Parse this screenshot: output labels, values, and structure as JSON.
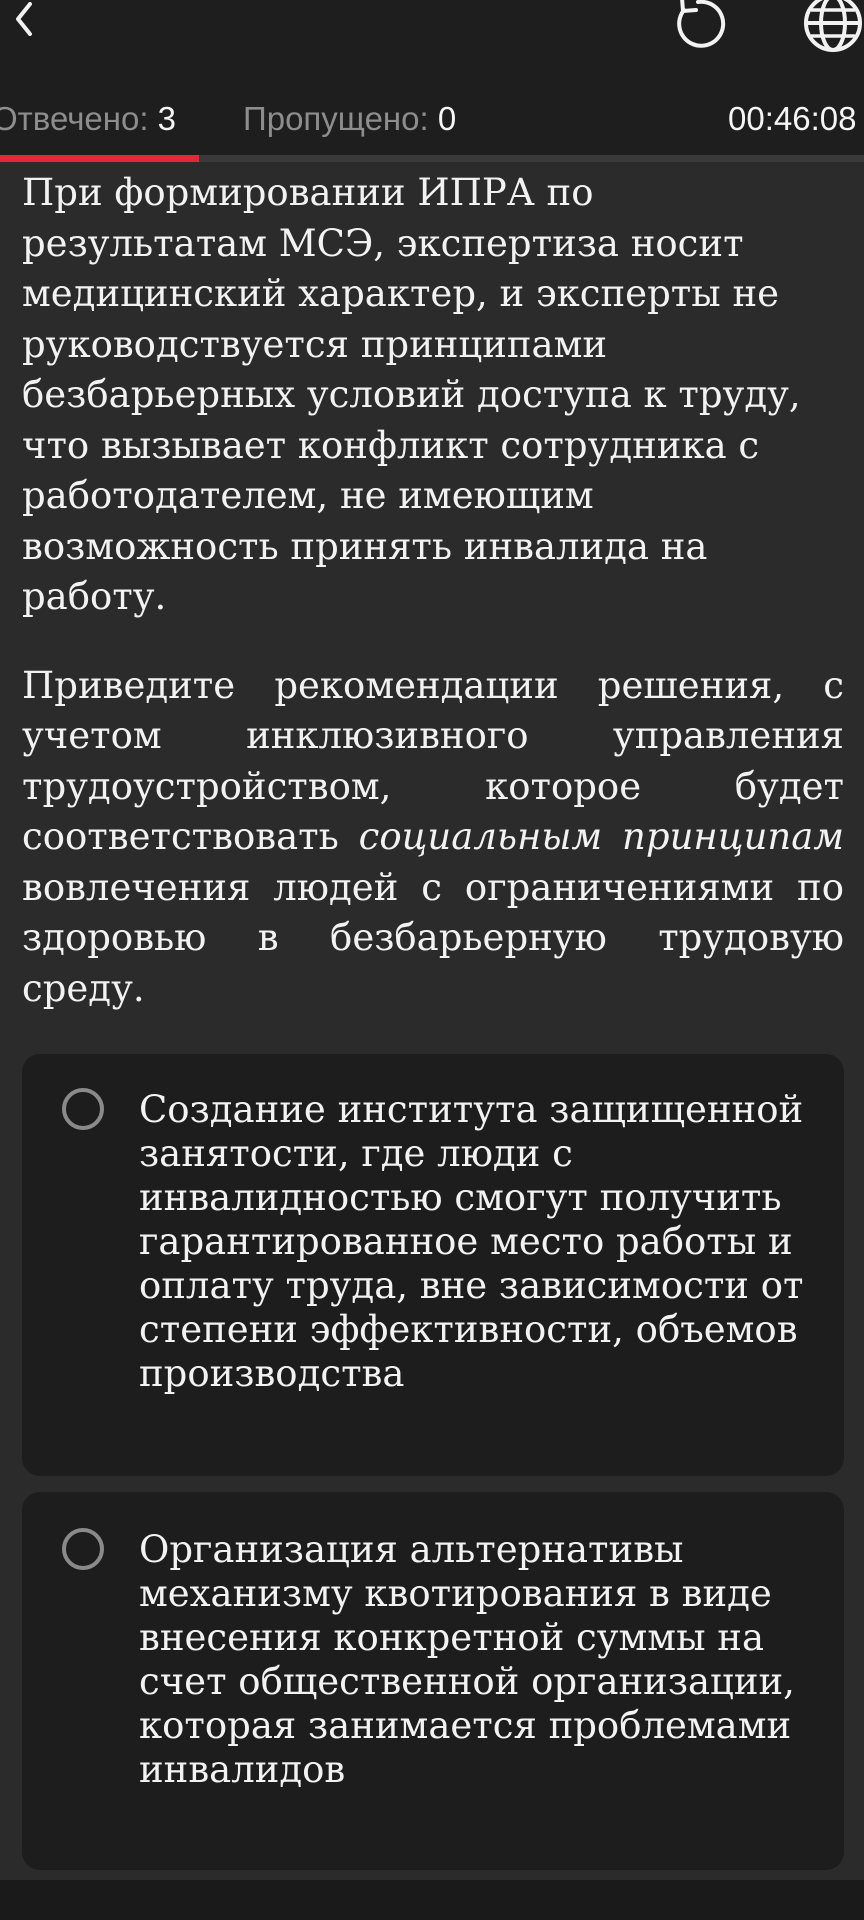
{
  "header": {
    "answered_label": "Отвечено:",
    "answered_value": "3",
    "skipped_label": "Пропущено:",
    "skipped_value": "0",
    "timer": "00:46:08",
    "progress_fraction": 0.23
  },
  "question": {
    "paragraph1": "При формировании ИПРА по результатам МСЭ, экспертиза носит медицинский характер, и эксперты не руководствуется принципами безбарьерных условий доступа к труду, что вызывает конфликт сотрудника с работодателем, не имеющим возможность принять инвалида на работу.",
    "paragraph2_before": "Приведите рекомендации решения, с учетом инклюзивного управления трудоустройством, которое будет соответствовать ",
    "paragraph2_em": "социальным принципам",
    "paragraph2_after": " вовлечения людей с ограничениями по здоровью в безбарьерную трудовую среду."
  },
  "options": [
    {
      "text": "Создание института защищенной занятости, где люди с инвалидностью смогут получить гарантированное место работы и оплату труда, вне зависимости от степени эффективности, объемов производства"
    },
    {
      "text": "Организация альтернативы механизму квотирования в виде внесения конкретной суммы на счет общественной организации, которая занимается проблемами инвалидов"
    }
  ],
  "colors": {
    "accent": "#e4283a",
    "background": "#2b2b2b",
    "header_bg": "#1e1e1e",
    "option_bg": "#1d1d1d"
  },
  "icons": [
    "back-icon",
    "reset-icon",
    "globe-icon"
  ]
}
